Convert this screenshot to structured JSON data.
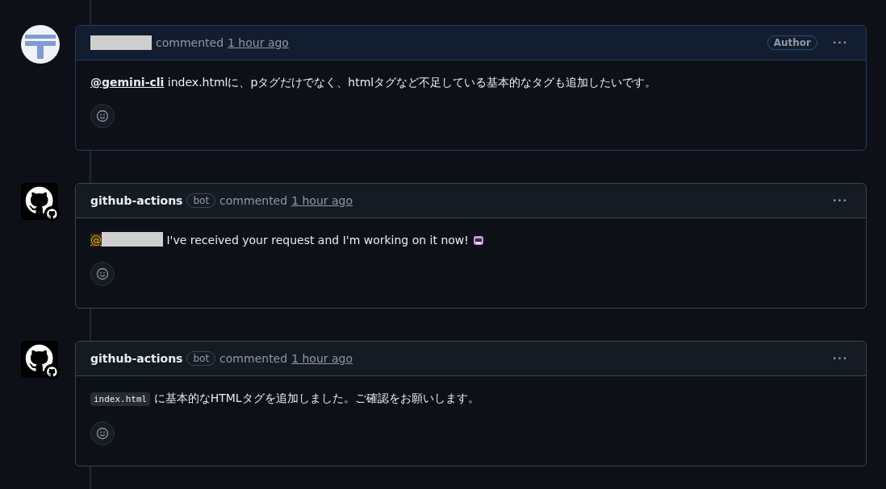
{
  "comments": [
    {
      "avatar": {
        "kind": "identicon"
      },
      "author_redacted": true,
      "highlighted": true,
      "action": "commented",
      "time": "1 hour ago",
      "role": "Author",
      "more": "···",
      "body": [
        {
          "kind": "mention",
          "text": "@gemini-cli"
        },
        {
          "kind": "text",
          "text": " index.htmlに、pタグだけでなく、htmlタグなど不足している基本的なタグも追加したいです。"
        }
      ]
    },
    {
      "avatar": {
        "kind": "github"
      },
      "author": "github-actions",
      "author_redacted": false,
      "bot": "bot",
      "highlighted": false,
      "action": "commented",
      "time": "1 hour ago",
      "more": "···",
      "body": [
        {
          "kind": "mention-redacted",
          "text": "@"
        },
        {
          "kind": "text",
          "text": " I've received your request and I'm working on it now! "
        },
        {
          "kind": "robot"
        }
      ]
    },
    {
      "avatar": {
        "kind": "github"
      },
      "author": "github-actions",
      "author_redacted": false,
      "bot": "bot",
      "highlighted": false,
      "action": "commented",
      "time": "1 hour ago",
      "more": "···",
      "body": [
        {
          "kind": "code",
          "text": "index.html"
        },
        {
          "kind": "text",
          "text": " に基本的なHTMLタグを追加しました。ご確認をお願いします。"
        }
      ]
    }
  ]
}
